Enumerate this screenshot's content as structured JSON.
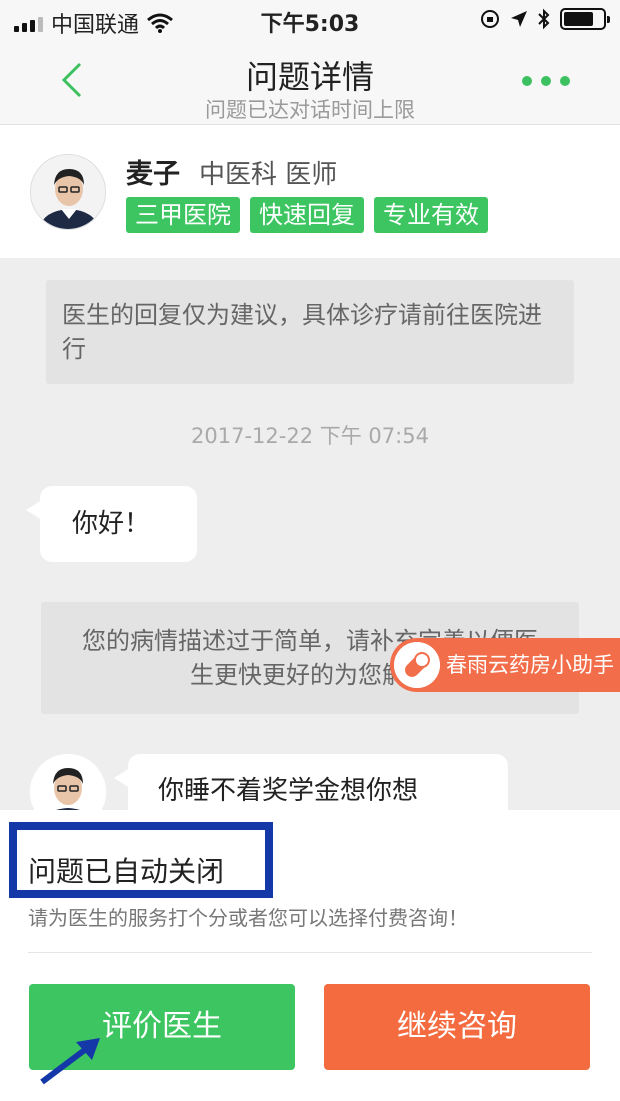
{
  "status_bar": {
    "carrier": "中国联通",
    "time": "下午5:03",
    "icons": [
      "signal-icon",
      "wifi-icon",
      "lock-rotation-icon",
      "location-icon",
      "bluetooth-icon",
      "battery-icon"
    ]
  },
  "nav": {
    "title": "问题详情",
    "subtitle": "问题已达对话时间上限",
    "back_icon": "chevron-left-icon",
    "more_icon": "more-dots-icon",
    "accent_color": "#3dc160"
  },
  "doctor": {
    "name": "麦子",
    "department": "中医科 医师",
    "tags": [
      "三甲医院",
      "快速回复",
      "专业有效"
    ],
    "tag_color": "#3cc561"
  },
  "chat": {
    "notice": "医生的回复仅为建议，具体诊疗请前往医院进行",
    "timestamp": "2017-12-22 下午 07:54",
    "messages": [
      {
        "from": "user",
        "text": "你好！"
      },
      {
        "from": "system",
        "text": "您的病情描述过于简单，请补充完善以便医生更快更好的为您解答"
      },
      {
        "from": "doctor",
        "text": "你睡不着奖学金想你想"
      }
    ]
  },
  "helper": {
    "label": "春雨云药房小助手",
    "icon": "pill-icon",
    "color": "#f26e4a"
  },
  "panel": {
    "closed_title": "问题已自动关闭",
    "closed_sub": "请为医生的服务打个分或者您可以选择付费咨询！",
    "rate_button": "评价医生",
    "continue_button": "继续咨询",
    "highlight_color": "#1438a8",
    "rate_color": "#3cc561",
    "continue_color": "#f46b3f"
  }
}
